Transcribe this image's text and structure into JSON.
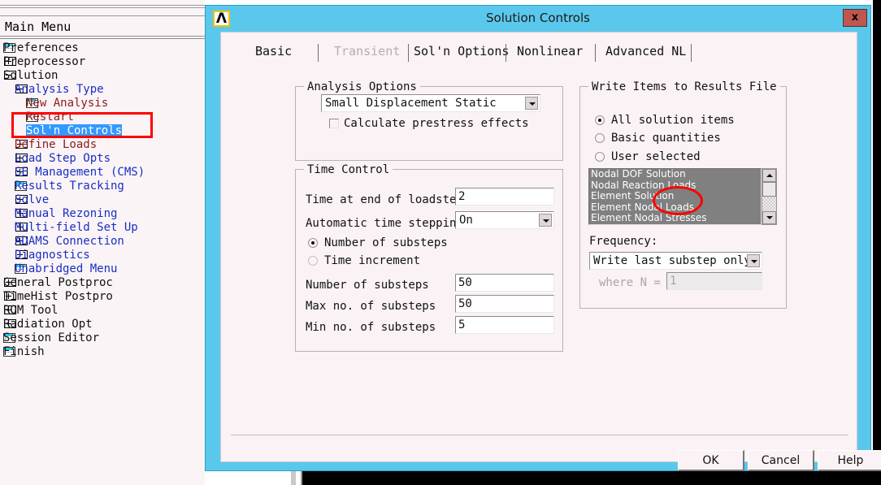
{
  "main_menu": {
    "header": "Main Menu",
    "items": [
      {
        "label": "Preferences",
        "icon": "doc-icon",
        "indent": 0,
        "color": "black"
      },
      {
        "label": "Preprocessor",
        "icon": "plus-icon",
        "indent": 0,
        "color": "black"
      },
      {
        "label": "Solution",
        "icon": "minus-icon",
        "indent": 0,
        "color": "black"
      },
      {
        "label": "Analysis Type",
        "icon": "minus-icon",
        "indent": 1,
        "color": "blue"
      },
      {
        "label": "New Analysis",
        "icon": "doc-icon",
        "indent": 2,
        "color": "red"
      },
      {
        "label": "Restart",
        "icon": "doc-icon",
        "indent": 2,
        "color": "red"
      },
      {
        "label": "Sol'n Controls",
        "icon": "doc-icon",
        "indent": 2,
        "color": "selected"
      },
      {
        "label": "Define Loads",
        "icon": "plus-icon",
        "indent": 1,
        "color": "red"
      },
      {
        "label": "Load Step Opts",
        "icon": "plus-icon",
        "indent": 1,
        "color": "blue"
      },
      {
        "label": "SE Management (CMS)",
        "icon": "plus-icon",
        "indent": 1,
        "color": "blue"
      },
      {
        "label": "Results Tracking",
        "icon": "doc-icon",
        "indent": 1,
        "color": "blue"
      },
      {
        "label": "Solve",
        "icon": "plus-icon",
        "indent": 1,
        "color": "blue"
      },
      {
        "label": "Manual Rezoning",
        "icon": "plus-icon",
        "indent": 1,
        "color": "blue"
      },
      {
        "label": "Multi-field Set Up",
        "icon": "plus-icon",
        "indent": 1,
        "color": "blue"
      },
      {
        "label": "ADAMS Connection",
        "icon": "plus-icon",
        "indent": 1,
        "color": "blue"
      },
      {
        "label": "Diagnostics",
        "icon": "plus-icon",
        "indent": 1,
        "color": "blue"
      },
      {
        "label": "Unabridged Menu",
        "icon": "doc-icon",
        "indent": 1,
        "color": "blue"
      },
      {
        "label": "General Postproc",
        "icon": "plus-icon",
        "indent": 0,
        "color": "black"
      },
      {
        "label": "TimeHist Postpro",
        "icon": "plus-icon",
        "indent": 0,
        "color": "black"
      },
      {
        "label": "ROM Tool",
        "icon": "plus-icon",
        "indent": 0,
        "color": "black"
      },
      {
        "label": "Radiation Opt",
        "icon": "plus-icon",
        "indent": 0,
        "color": "black"
      },
      {
        "label": "Session Editor",
        "icon": "doc-icon",
        "indent": 0,
        "color": "black"
      },
      {
        "label": "Finish",
        "icon": "doc-icon",
        "indent": 0,
        "color": "black"
      }
    ],
    "highlight_color": "#ff0000"
  },
  "dialog": {
    "title": "Solution Controls",
    "logo": "Λ",
    "close_label": "x",
    "titlebar_color": "#5ac8ec",
    "close_color": "#c0564e",
    "tabs": [
      {
        "label": "Basic",
        "state": "active"
      },
      {
        "label": "Transient",
        "state": "disabled"
      },
      {
        "label": "Sol'n Options",
        "state": "enabled"
      },
      {
        "label": "Nonlinear",
        "state": "enabled"
      },
      {
        "label": "Advanced NL",
        "state": "enabled"
      }
    ],
    "analysis_options": {
      "group_label": "Analysis Options",
      "analysis_type": "Small Displacement Static",
      "prestress_label": "Calculate prestress effects",
      "prestress_checked": false
    },
    "time_control": {
      "group_label": "Time Control",
      "time_end_label": "Time at end of loadstep",
      "time_end_value": "2",
      "auto_time_label": "Automatic time stepping",
      "auto_time_value": "On",
      "radio_substeps_label": "Number of substeps",
      "radio_time_increment_label": "Time increment",
      "radio_selected": "substeps",
      "num_substeps_label": "Number of substeps",
      "num_substeps_value": "50",
      "max_substeps_label": "Max no. of substeps",
      "max_substeps_value": "50",
      "min_substeps_label": "Min no. of substeps",
      "min_substeps_value": "5"
    },
    "write_items": {
      "group_label": "Write Items to Results File",
      "radios": [
        {
          "label": "All solution items",
          "selected": true,
          "disabled": false
        },
        {
          "label": "Basic quantities",
          "selected": false,
          "disabled": false
        },
        {
          "label": "User selected",
          "selected": false,
          "disabled": false
        }
      ],
      "list_items": [
        "Nodal DOF Solution",
        "Nodal Reaction Loads",
        "Element Solution",
        "Element Nodal Loads",
        "Element Nodal Stresses"
      ],
      "frequency_label": "Frequency:",
      "frequency_value": "Write last substep only",
      "where_n_label": "where N =",
      "where_n_value": "1"
    },
    "buttons": {
      "ok": "OK",
      "cancel": "Cancel",
      "help": "Help"
    }
  },
  "annotation": {
    "ellipse_color": "#ff0000",
    "highlight_box_color": "#ff0000"
  }
}
